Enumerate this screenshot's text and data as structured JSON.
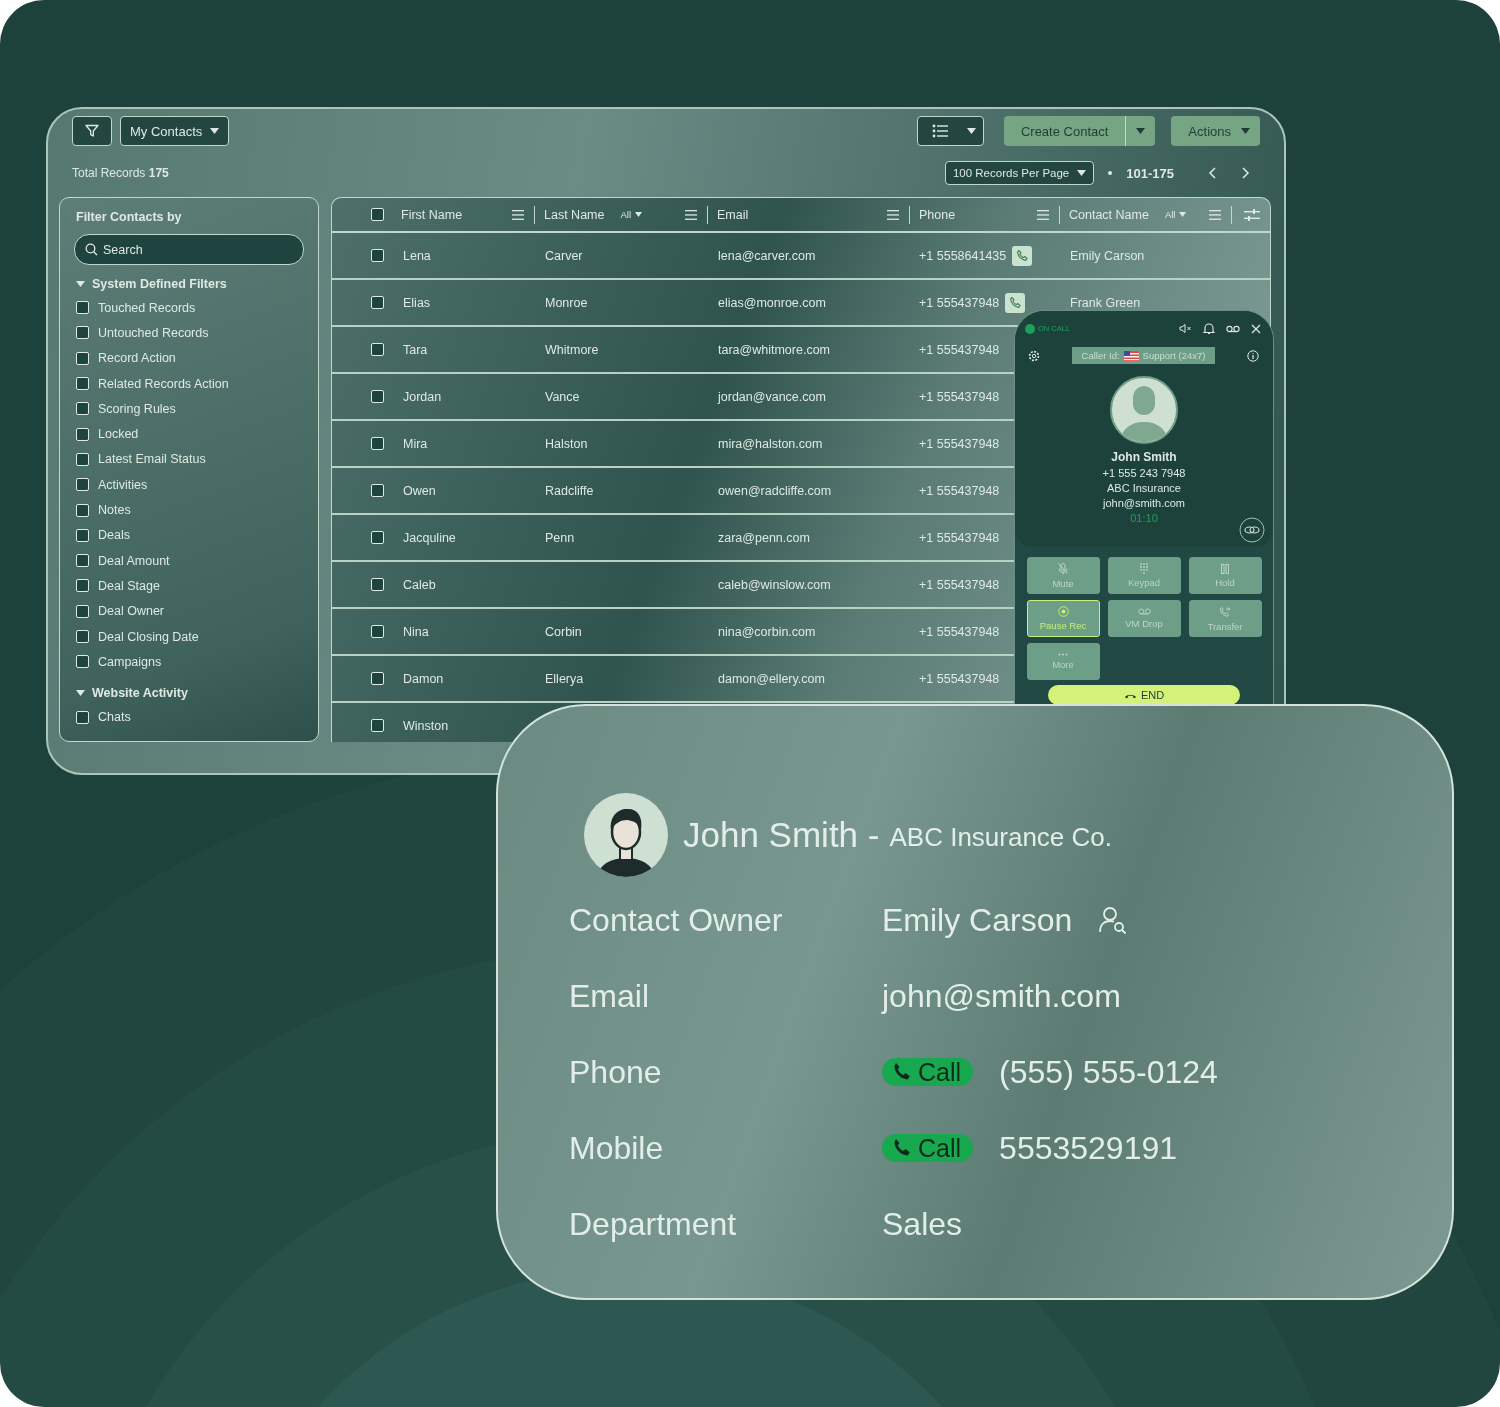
{
  "toolbar": {
    "view_menu": "My Contacts",
    "create_button": "Create Contact",
    "actions_button": "Actions"
  },
  "summary": {
    "label": "Total Records",
    "count": "175",
    "per_page": "100 Records Per Page",
    "range": "101-175"
  },
  "filters": {
    "title": "Filter Contacts by",
    "search": {
      "placeholder": "Search"
    },
    "groups": [
      {
        "title": "System Defined Filters",
        "expanded": true,
        "items": [
          {
            "label": "Touched Records",
            "checked": false
          },
          {
            "label": "Untouched Records",
            "checked": false
          },
          {
            "label": "Record Action",
            "checked": false
          },
          {
            "label": "Related Records Action",
            "checked": false
          },
          {
            "label": "Scoring Rules",
            "checked": false
          },
          {
            "label": "Locked",
            "checked": false
          },
          {
            "label": "Latest Email Status",
            "checked": false
          },
          {
            "label": "Activities",
            "checked": false
          },
          {
            "label": "Notes",
            "checked": false
          },
          {
            "label": "Deals",
            "checked": false
          },
          {
            "label": "Deal Amount",
            "checked": false
          },
          {
            "label": "Deal Stage",
            "checked": false
          },
          {
            "label": "Deal Owner",
            "checked": false
          },
          {
            "label": "Deal Closing Date",
            "checked": false
          },
          {
            "label": "Campaigns",
            "checked": false
          }
        ]
      },
      {
        "title": "Website Activity",
        "expanded": true,
        "items": [
          {
            "label": "Chats",
            "checked": false
          }
        ]
      }
    ]
  },
  "table": {
    "all_selected": false,
    "columns": [
      {
        "label": "First Name"
      },
      {
        "label": "Last Name",
        "filter": "All"
      },
      {
        "label": "Email"
      },
      {
        "label": "Phone"
      },
      {
        "label": "Contact Name",
        "filter": "All"
      }
    ],
    "rows": [
      {
        "selected": false,
        "first_name": "Lena",
        "last_name": "Carver",
        "email": "lena@carver.com",
        "phone": "+1 5558641435",
        "call_button": true,
        "contact_name": "Emily Carson"
      },
      {
        "selected": false,
        "first_name": "Elias",
        "last_name": "Monroe",
        "email": "elias@monroe.com",
        "phone": "+1 555437948",
        "call_button": true,
        "contact_name": "Frank Green"
      },
      {
        "selected": false,
        "first_name": "Tara",
        "last_name": "Whitmore",
        "email": "tara@whitmore.com",
        "phone": "+1 555437948"
      },
      {
        "selected": false,
        "first_name": "Jordan",
        "last_name": "Vance",
        "email": "jordan@vance.com",
        "phone": "+1 555437948"
      },
      {
        "selected": false,
        "first_name": "Mira",
        "last_name": "Halston",
        "email": "mira@halston.com",
        "phone": "+1 555437948"
      },
      {
        "selected": false,
        "first_name": "Owen",
        "last_name": "Radcliffe",
        "email": "owen@radcliffe.com",
        "phone": "+1 555437948"
      },
      {
        "selected": false,
        "first_name": "Jacquline",
        "last_name": "Penn",
        "email": "zara@penn.com",
        "phone": "+1 555437948"
      },
      {
        "selected": false,
        "first_name": "Caleb",
        "email": "caleb@winslow.com",
        "phone": "+1 555437948"
      },
      {
        "selected": false,
        "first_name": "Nina",
        "last_name": "Corbin",
        "email": "nina@corbin.com",
        "phone": "+1 555437948"
      },
      {
        "selected": false,
        "first_name": "Damon",
        "last_name": "Ellerya",
        "email": "damon@ellery.com",
        "phone": "+1 555437948"
      },
      {
        "selected": false,
        "first_name": "Winston"
      }
    ]
  },
  "dialer": {
    "status": "ON CALL",
    "caller_id_label": "Caller Id:",
    "caller_id": "Support (24x7)",
    "name": "John Smith",
    "phone": "+1 555 243 7948",
    "company": "ABC Insurance",
    "email": "john@smith.com",
    "timer": "01:10",
    "buttons": [
      {
        "kind": "mute",
        "label": "Mute",
        "selected": false
      },
      {
        "kind": "keypad",
        "label": "Keypad",
        "selected": false
      },
      {
        "kind": "hold",
        "label": "Hold",
        "selected": false
      },
      {
        "kind": "record",
        "label": "Pause Rec",
        "selected": true
      },
      {
        "kind": "voicemail",
        "label": "VM Drop",
        "selected": false
      },
      {
        "kind": "transfer",
        "label": "Transfer",
        "selected": false
      },
      {
        "kind": "more",
        "label": "More",
        "selected": false
      }
    ],
    "end_button": "END"
  },
  "contact_card": {
    "name": "John Smith -",
    "company": "ABC Insurance Co.",
    "fields": [
      {
        "kind": "owner",
        "label": "Contact Owner",
        "value": "Emily Carson"
      },
      {
        "kind": "text",
        "label": "Email",
        "value": "john@smith.com"
      },
      {
        "kind": "phone",
        "label": "Phone",
        "action": "Call",
        "value": "(555) 555-0124"
      },
      {
        "kind": "phone",
        "label": "Mobile",
        "action": "Call",
        "value": "5553529191"
      },
      {
        "kind": "text",
        "label": "Department",
        "value": "Sales"
      }
    ]
  }
}
